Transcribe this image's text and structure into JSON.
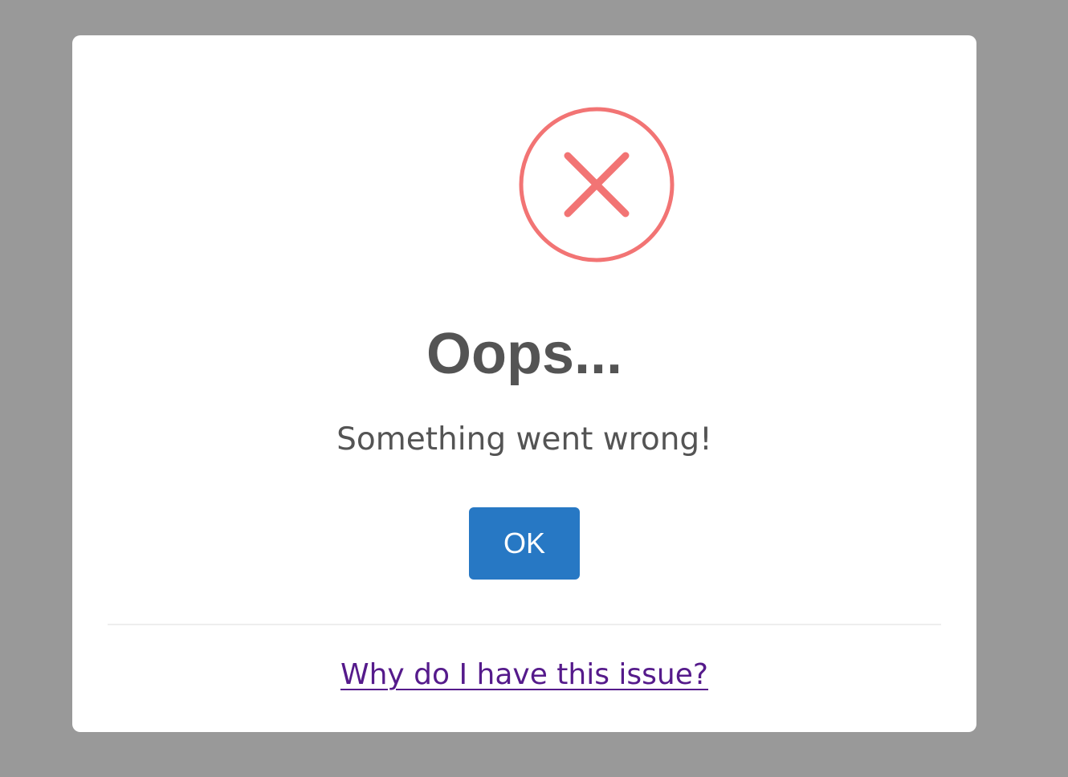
{
  "dialog": {
    "icon": "error-x-icon",
    "icon_color": "#f27474",
    "title": "Oops...",
    "message": "Something went wrong!",
    "confirm_label": "OK",
    "confirm_color": "#2778c4",
    "footer_link_text": "Why do I have this issue?",
    "footer_link_color": "#551a8b"
  },
  "colors": {
    "backdrop": "#999999",
    "modal_background": "#ffffff",
    "text": "#545454"
  }
}
